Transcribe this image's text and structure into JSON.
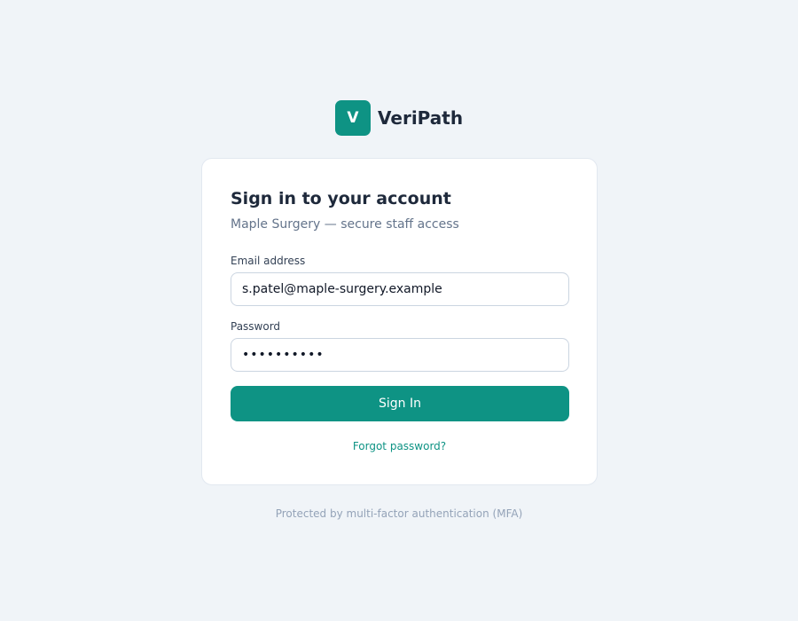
{
  "brand": {
    "logo_letter": "V",
    "name": "VeriPath"
  },
  "login": {
    "title": "Sign in to your account",
    "subtitle": "Maple Surgery — secure staff access",
    "email": {
      "label": "Email address",
      "value": "s.patel@maple-surgery.example"
    },
    "password": {
      "label": "Password",
      "masked_value": "••••••••••"
    },
    "signin_label": "Sign In",
    "forgot_label": "Forgot password?"
  },
  "footer": {
    "note": "Protected by multi-factor authentication (MFA)"
  },
  "colors": {
    "accent": "#0e9384",
    "background": "#f0f4f8",
    "card": "#ffffff"
  }
}
